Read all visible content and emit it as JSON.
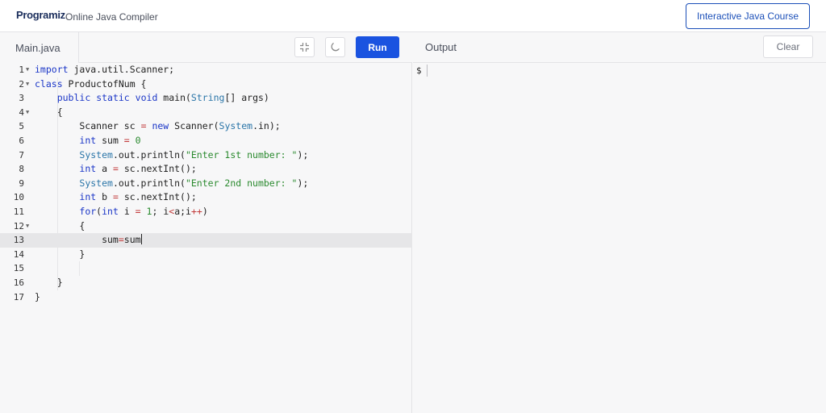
{
  "header": {
    "logo_text": "Programiz",
    "title": "Online Java Compiler",
    "course_button": "Interactive Java Course"
  },
  "editor": {
    "tab_label": "Main.java",
    "run_label": "Run",
    "icons": [
      "collapse-icon",
      "moon-icon"
    ],
    "active_line": 13,
    "lines": [
      "import java.util.Scanner;",
      "class ProductofNum {",
      "    public static void main(String[] args)",
      "    {",
      "        Scanner sc = new Scanner(System.in);",
      "        int sum = 0",
      "        System.out.println(\"Enter 1st number: \");",
      "        int a = sc.nextInt();",
      "        System.out.println(\"Enter 2nd number: \");",
      "        int b = sc.nextInt();",
      "        for(int i = 1; i<a;i++)",
      "        {",
      "            sum=sum",
      "        }",
      "",
      "    }",
      "}"
    ],
    "line_numbers": [
      "1",
      "2",
      "3",
      "4",
      "5",
      "6",
      "7",
      "8",
      "9",
      "10",
      "11",
      "12",
      "13",
      "14",
      "15",
      "16",
      "17"
    ]
  },
  "output": {
    "title": "Output",
    "clear_label": "Clear",
    "prompt": "$"
  },
  "colors": {
    "accent": "#1a53e0",
    "keyword": "#1b36c7",
    "string": "#2b8a2f"
  }
}
